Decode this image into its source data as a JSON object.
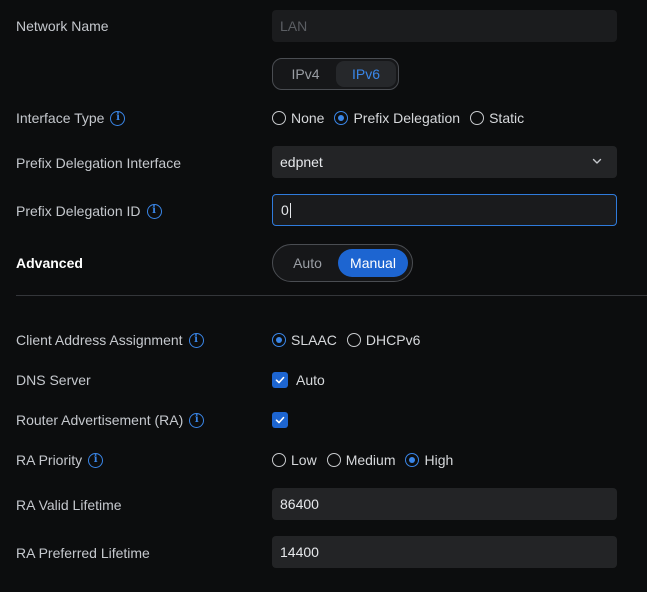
{
  "network_name": {
    "label": "Network Name",
    "value": "LAN"
  },
  "ip_version": {
    "options": [
      "IPv4",
      "IPv6"
    ],
    "selected": "IPv6"
  },
  "interface_type": {
    "label": "Interface Type",
    "options": [
      "None",
      "Prefix Delegation",
      "Static"
    ],
    "selected": "Prefix Delegation"
  },
  "prefix_delegation_interface": {
    "label": "Prefix Delegation Interface",
    "value": "edpnet"
  },
  "prefix_delegation_id": {
    "label": "Prefix Delegation ID",
    "value": "0"
  },
  "advanced": {
    "label": "Advanced",
    "options": [
      "Auto",
      "Manual"
    ],
    "selected": "Manual"
  },
  "client_address_assignment": {
    "label": "Client Address Assignment",
    "options": [
      "SLAAC",
      "DHCPv6"
    ],
    "selected": "SLAAC"
  },
  "dns_server": {
    "label": "DNS Server",
    "checkbox_label": "Auto",
    "checked": true
  },
  "router_advertisement": {
    "label": "Router Advertisement (RA)",
    "checked": true
  },
  "ra_priority": {
    "label": "RA Priority",
    "options": [
      "Low",
      "Medium",
      "High"
    ],
    "selected": "High"
  },
  "ra_valid_lifetime": {
    "label": "RA Valid Lifetime",
    "value": "86400"
  },
  "ra_preferred_lifetime": {
    "label": "RA Preferred Lifetime",
    "value": "14400"
  },
  "colors": {
    "accent": "#1d65d1",
    "accent_text": "#3a86e8",
    "background": "#0c0d0e",
    "field": "#232426"
  },
  "icons": {
    "info": "info-icon",
    "dropdown": "chevron-down-icon",
    "check": "checkmark-icon"
  }
}
